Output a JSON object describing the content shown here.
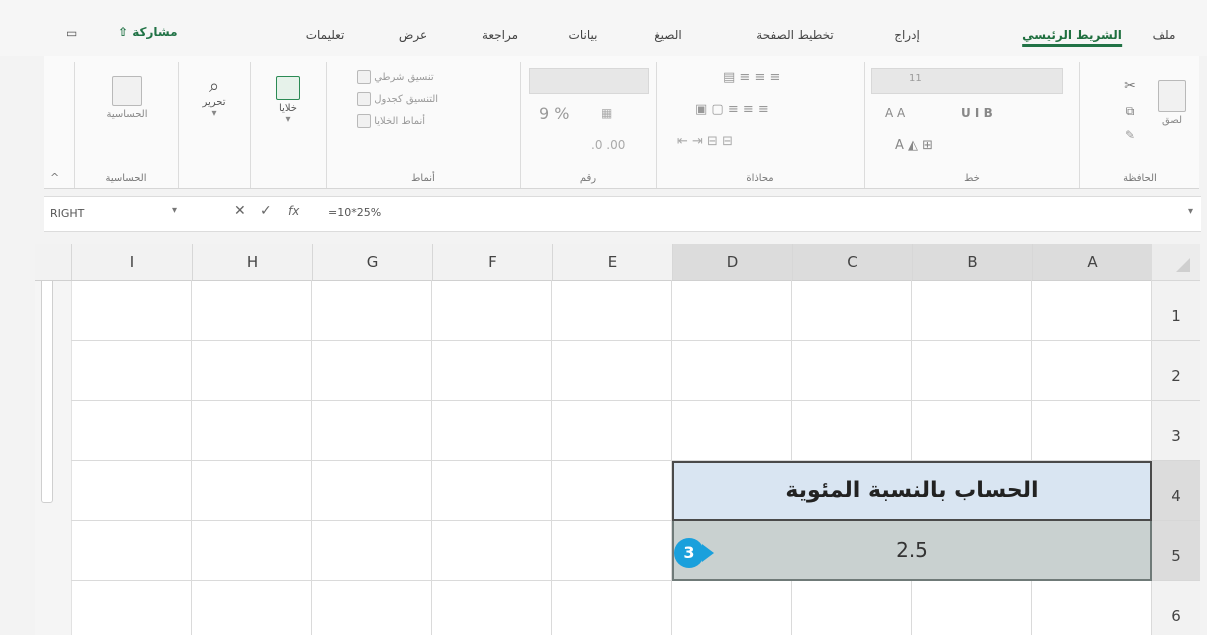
{
  "ribbon": {
    "tabs": [
      "ملف",
      "الشريط الرئيسي",
      "إدراج",
      "تخطيط الصفحة",
      "الصيغ",
      "بيانات",
      "مراجعة",
      "عرض",
      "تعليمات"
    ],
    "active_tab": "الشريط الرئيسي",
    "share_label": "مشاركة",
    "groups": {
      "clipboard": {
        "label": "الحافظة",
        "paste": "لصق"
      },
      "font": {
        "label": "خط",
        "size": "11"
      },
      "alignment": {
        "label": "محاذاة"
      },
      "number": {
        "label": "رقم",
        "percent": "%"
      },
      "styles": {
        "label": "أنماط",
        "conditional": "تنسيق شرطي",
        "as_table": "التنسيق كجدول",
        "cell_styles": "أنماط الخلايا"
      },
      "cells": {
        "label": "خلايا",
        "btn": "خلايا"
      },
      "editing": {
        "label": "تحرير",
        "btn": "تحرير"
      },
      "sensitivity": {
        "label": "الحساسية",
        "btn": "الحساسية"
      }
    }
  },
  "formula_bar": {
    "name_box": "RIGHT",
    "formula": "=10*25%",
    "fx": "fx",
    "cancel": "✕",
    "enter": "✓"
  },
  "grid": {
    "columns": [
      "I",
      "H",
      "G",
      "F",
      "E",
      "D",
      "C",
      "B",
      "A"
    ],
    "rows": [
      "1",
      "2",
      "3",
      "4",
      "5",
      "6"
    ],
    "title_text": "الحساب بالنسبة المئوية",
    "value_text": "2.5",
    "step_number": "3"
  },
  "colors": {
    "accent": "#217346",
    "title_fill": "#d9e5f2",
    "value_fill": "#c9d1d0",
    "badge": "#1aa0dc"
  }
}
